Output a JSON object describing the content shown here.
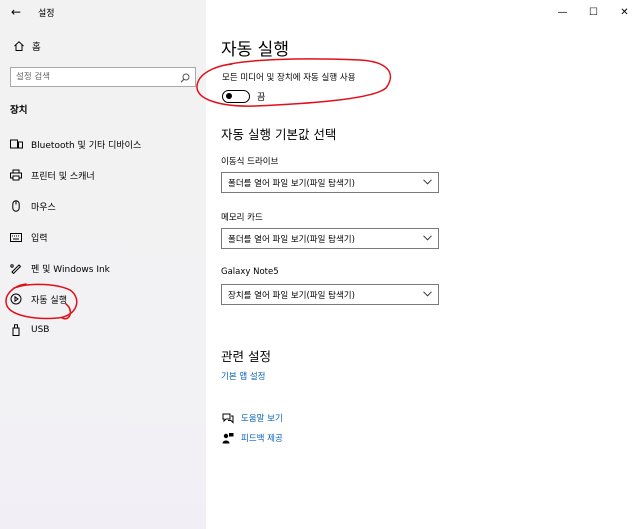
{
  "window": {
    "back_glyph": "←",
    "app_title": "설정",
    "minimize_glyph": "—",
    "maximize_glyph": "☐",
    "close_glyph": "✕"
  },
  "sidebar": {
    "home_label": "홈",
    "search_placeholder": "설정 검색",
    "section_heading": "장치",
    "items": [
      {
        "label": "Bluetooth 및 기타 디바이스",
        "icon": "bluetooth-devices-icon"
      },
      {
        "label": "프린터 및 스캐너",
        "icon": "printer-icon"
      },
      {
        "label": "마우스",
        "icon": "mouse-icon"
      },
      {
        "label": "입력",
        "icon": "keyboard-icon"
      },
      {
        "label": "펜 및 Windows Ink",
        "icon": "pen-icon"
      },
      {
        "label": "자동 실행",
        "icon": "autoplay-icon"
      },
      {
        "label": "USB",
        "icon": "usb-icon"
      }
    ]
  },
  "main": {
    "title": "자동 실행",
    "toggle_label": "모든 미디어 및 장치에 자동 실행 사용",
    "toggle_state": "끔",
    "toggle_on": false,
    "defaults_heading": "자동 실행 기본값 선택",
    "devices": [
      {
        "label": "이동식 드라이브",
        "value": "폴더를 열어 파일 보기(파일 탐색기)"
      },
      {
        "label": "메모리 카드",
        "value": "폴더를 열어 파일 보기(파일 탐색기)"
      },
      {
        "label": "Galaxy Note5",
        "value": "장치를 열어 파일 보기(파일 탐색기)"
      }
    ],
    "related_heading": "관련 설정",
    "related_link": "기본 앱 설정",
    "help_link": "도움말 보기",
    "feedback_link": "피드백 제공"
  },
  "colors": {
    "link": "#0a63b8",
    "annotation": "#e0101a",
    "sidebar_bg": "#f2f2f2"
  }
}
